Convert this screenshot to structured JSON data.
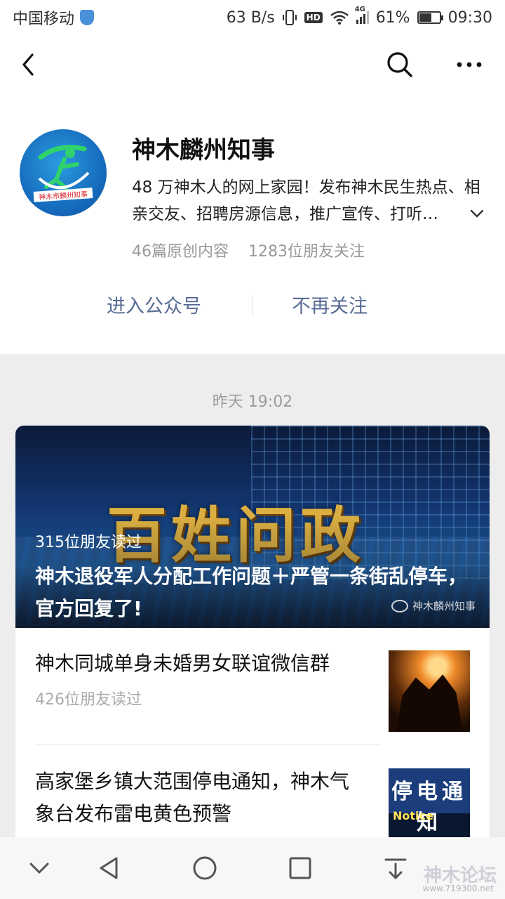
{
  "status_bar": {
    "carrier": "中国移动",
    "net_speed": "63 B/s",
    "hd": "HD",
    "network_type": "4G",
    "battery": "61%",
    "battery_level": 0.61,
    "time": "09:30"
  },
  "profile": {
    "avatar_text": "神木市麟州知事",
    "name": "神木麟州知事",
    "description": "48 万神木人的网上家园！发布神木民生热点、相亲交友、招聘房源信息，推广宣传、打听…",
    "original_count": "46篇原创内容",
    "followers": "1283位朋友关注",
    "enter_label": "进入公众号",
    "unfollow_label": "不再关注"
  },
  "feed": {
    "timestamp": "昨天 19:02",
    "cover": {
      "logo_text": "百姓问政",
      "readers": "315位朋友读过",
      "title": "神木退役军人分配工作问题＋严管一条街乱停车，官方回复了!",
      "watermark": "神木麟州知事"
    },
    "items": [
      {
        "title": "神木同城单身未婚男女联谊微信群",
        "readers": "426位朋友读过"
      },
      {
        "title": "高家堡乡镇大范围停电通知，神木气象台发布雷电黄色预警",
        "readers": "",
        "thumb_text": "停电通知",
        "thumb_sub": "Notice"
      }
    ]
  },
  "overlay_watermark": {
    "text": "神木论坛",
    "url": "www.719300.net"
  },
  "icons": {
    "back": "chevron-left-icon",
    "search": "search-icon",
    "more": "more-dots-icon",
    "expand": "chevron-down-icon",
    "nav_down": "chevron-down-icon",
    "nav_back": "triangle-back-icon",
    "nav_home": "circle-home-icon",
    "nav_recent": "square-recent-icon",
    "nav_notification": "pull-down-icon"
  },
  "colors": {
    "link": "#576b95",
    "background": "#ededed",
    "secondary_text": "#999999"
  }
}
